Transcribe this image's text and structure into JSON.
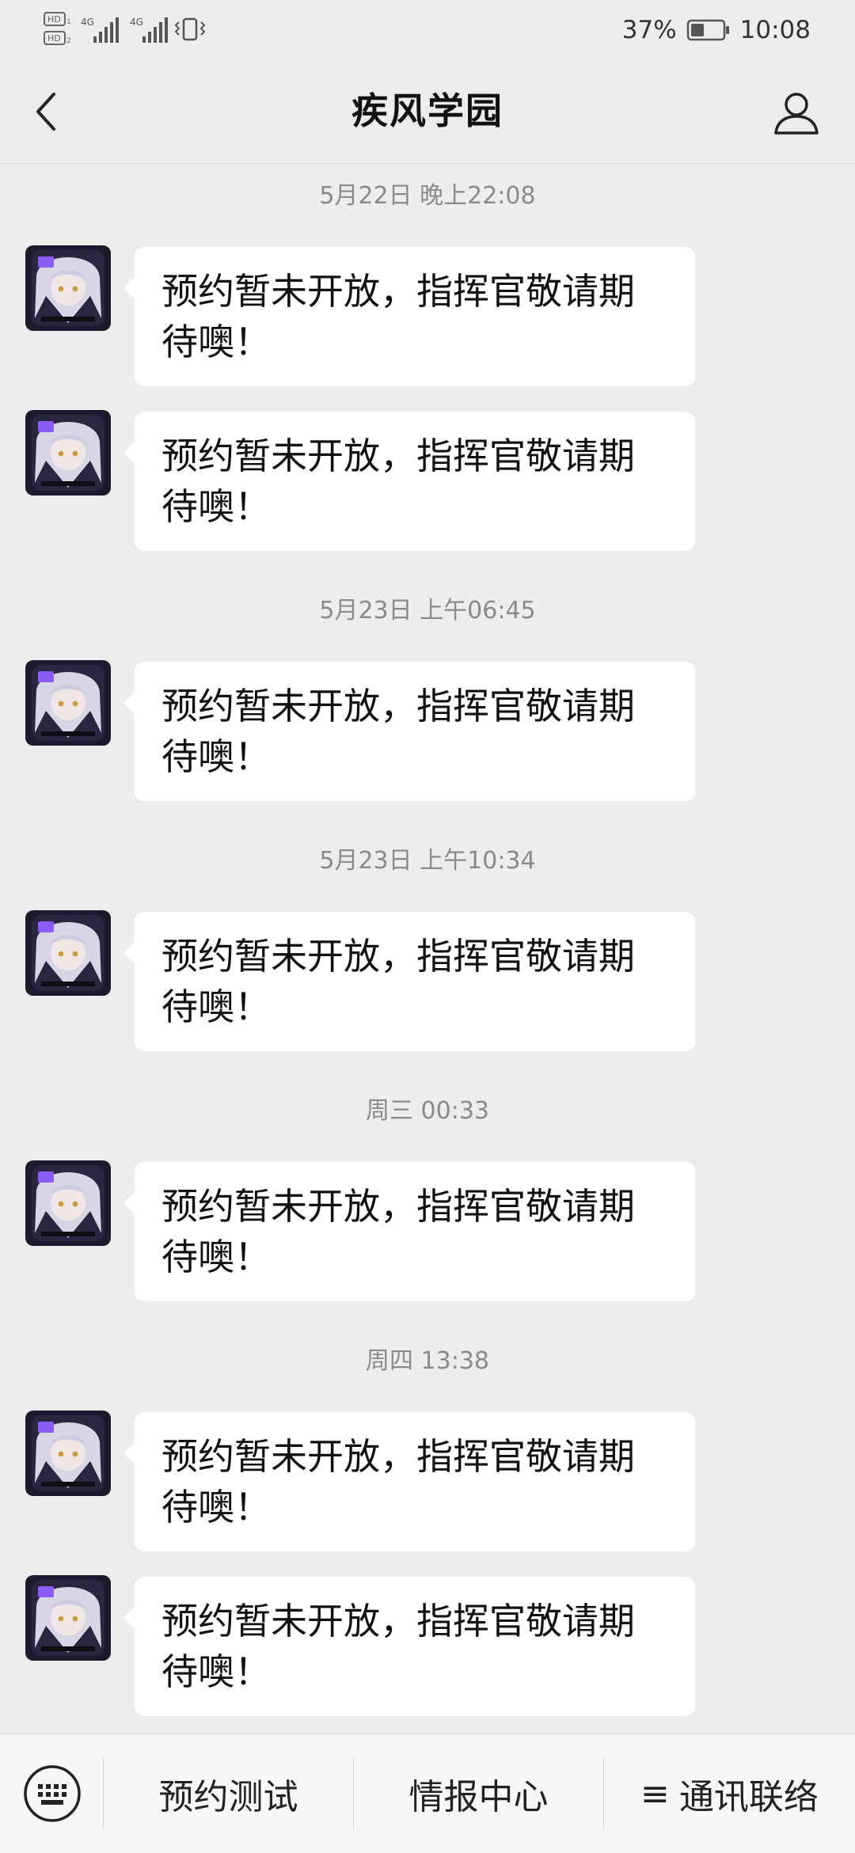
{
  "status_bar": {
    "network_1": "4G",
    "network_2": "4G",
    "battery_percent": "37%",
    "time": "10:08"
  },
  "header": {
    "title": "疾风学园",
    "back_icon": "chevron-left-icon",
    "profile_icon": "user-icon"
  },
  "messages": {
    "timestamps": [
      "5月22日 晚上22:08",
      "5月23日 上午06:45",
      "5月23日 上午10:34",
      "周三 00:33",
      "周四 13:38"
    ],
    "items": [
      {
        "text": "预约暂未开放，指挥官敬请期待噢！"
      },
      {
        "text": "预约暂未开放，指挥官敬请期待噢！"
      },
      {
        "text": "预约暂未开放，指挥官敬请期待噢！"
      },
      {
        "text": "预约暂未开放，指挥官敬请期待噢！"
      },
      {
        "text": "预约暂未开放，指挥官敬请期待噢！"
      },
      {
        "text": "预约暂未开放，指挥官敬请期待噢！"
      },
      {
        "text": "预约暂未开放，指挥官敬请期待噢！"
      }
    ]
  },
  "bottom_menu": {
    "keyboard_icon": "keyboard-icon",
    "items": [
      {
        "label": "预约测试"
      },
      {
        "label": "情报中心"
      },
      {
        "prefix": "≡",
        "label": "通讯联络"
      }
    ]
  },
  "colors": {
    "background": "#ededed",
    "bubble": "#ffffff",
    "timestamp_text": "#8a8a8a",
    "avatar_accent": "#8b5cf6"
  }
}
